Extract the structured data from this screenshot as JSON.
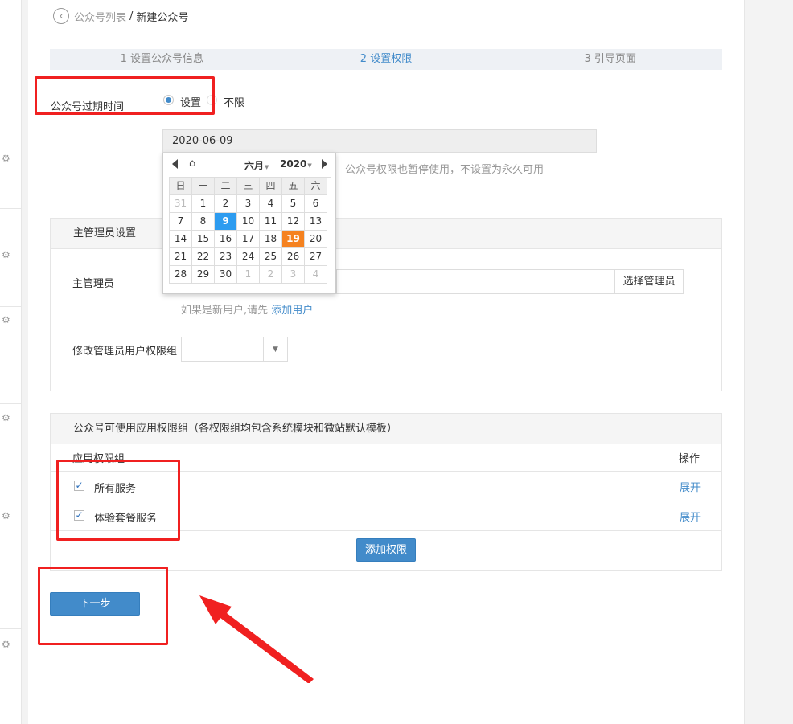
{
  "breadcrumb": {
    "parent": "公众号列表",
    "separator": "/",
    "current": "新建公众号"
  },
  "steps": [
    {
      "label": "1 设置公众号信息",
      "active": false
    },
    {
      "label": "2 设置权限",
      "active": true
    },
    {
      "label": "3 引导页面",
      "active": false
    }
  ],
  "expiry": {
    "label": "公众号过期时间",
    "option_set": "设置",
    "option_unlimited": "不限",
    "selected": "设置",
    "date_value": "2020-06-09",
    "hint": "公众号权限也暂停使用，不设置为永久可用"
  },
  "calendar": {
    "month_label": "六月",
    "year_label": "2020",
    "weekdays": [
      "日",
      "一",
      "二",
      "三",
      "四",
      "五",
      "六"
    ],
    "weeks": [
      [
        "31",
        "1",
        "2",
        "3",
        "4",
        "5",
        "6"
      ],
      [
        "7",
        "8",
        "9",
        "10",
        "11",
        "12",
        "13"
      ],
      [
        "14",
        "15",
        "16",
        "17",
        "18",
        "19",
        "20"
      ],
      [
        "21",
        "22",
        "23",
        "24",
        "25",
        "26",
        "27"
      ],
      [
        "28",
        "29",
        "30",
        "1",
        "2",
        "3",
        "4"
      ]
    ],
    "selected_day": "9",
    "today_day": "19"
  },
  "admin_panel": {
    "title": "主管理员设置",
    "admin_label": "主管理员",
    "choose_button": "选择管理员",
    "new_user_hint": "如果是新用户,请先",
    "add_user_link": "添加用户",
    "permission_group_label": "修改管理员用户权限组"
  },
  "app_panel": {
    "title": "公众号可使用应用权限组（各权限组均包含系统模块和微站默认模板）",
    "col_group": "应用权限组",
    "col_action": "操作",
    "rows": [
      {
        "name": "所有服务",
        "checked": true,
        "action": "展开"
      },
      {
        "name": "体验套餐服务",
        "checked": true,
        "action": "展开"
      }
    ],
    "add_button": "添加权限"
  },
  "next_button": "下一步",
  "colors": {
    "primary": "#428bca",
    "annotation": "#f02020",
    "today": "#f58220",
    "selected": "#2d9cf0"
  }
}
